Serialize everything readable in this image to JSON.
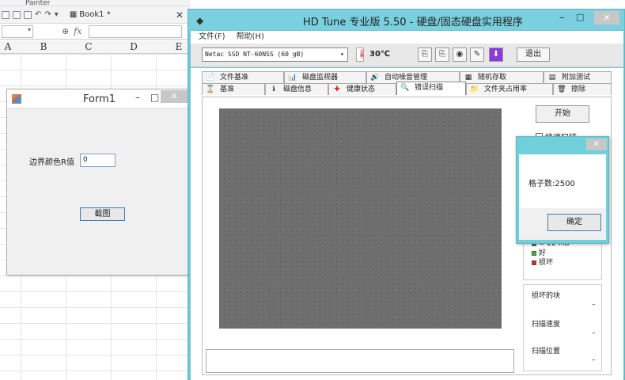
{
  "excel": {
    "ribbon_label": "Painter",
    "workbook_tab": "Book1 *",
    "fx_label": "fx",
    "columns": [
      "A",
      "B",
      "C",
      "D",
      "E"
    ]
  },
  "form1": {
    "title": "Form1",
    "border_label": "边界颜色R值",
    "border_value": "0",
    "capture_button": "截图"
  },
  "hdtune": {
    "title": "HD Tune 专业版 5.50 - 硬盘/固态硬盘实用程序",
    "menu": [
      "文件(F)",
      "帮助(H)"
    ],
    "drive": "Netac SSD NT-60NSS (60 gB)",
    "temperature": "30℃",
    "exit_button": "退出",
    "tabs_row1": [
      {
        "label": "文件基准",
        "icon": "document-icon",
        "glyph": "📄"
      },
      {
        "label": "磁盘监视器",
        "icon": "monitor-icon",
        "glyph": "📊"
      },
      {
        "label": "自动噪音管理",
        "icon": "speaker-icon",
        "glyph": "🔊"
      },
      {
        "label": "随机存取",
        "icon": "random-icon",
        "glyph": "▦"
      },
      {
        "label": "附加测试",
        "icon": "test-icon",
        "glyph": "▤"
      }
    ],
    "tabs_row2": [
      {
        "label": "基准",
        "icon": "benchmark-icon",
        "glyph": "⌛"
      },
      {
        "label": "磁盘信息",
        "icon": "info-icon",
        "glyph": "ℹ"
      },
      {
        "label": "健康状态",
        "icon": "health-icon",
        "glyph": "✚"
      },
      {
        "label": "错误扫描",
        "icon": "scan-icon",
        "glyph": "🔍"
      },
      {
        "label": "文件夹占用率",
        "icon": "folder-icon",
        "glyph": "📁"
      },
      {
        "label": "擦除",
        "icon": "erase-icon",
        "glyph": "🗑"
      }
    ],
    "start_button": "开始",
    "quick_scan_label": "快速扫描",
    "legend": {
      "block_size": "= 22 MB",
      "good": "好",
      "damaged": "损坏"
    },
    "stats": {
      "damaged_blocks_label": "损坏的块",
      "damaged_blocks_value": "–",
      "scan_speed_label": "扫描速度",
      "scan_speed_value": "–",
      "scan_position_label": "扫描位置",
      "scan_position_value": "–"
    }
  },
  "msgbox": {
    "text": "格子数:2500",
    "ok_button": "确定"
  },
  "colors": {
    "window_frame": "#6fc8d6",
    "block_fill": "#6f6f6f",
    "block_grid": "#222222",
    "good": "#22cc22",
    "damaged": "#dd2222"
  }
}
